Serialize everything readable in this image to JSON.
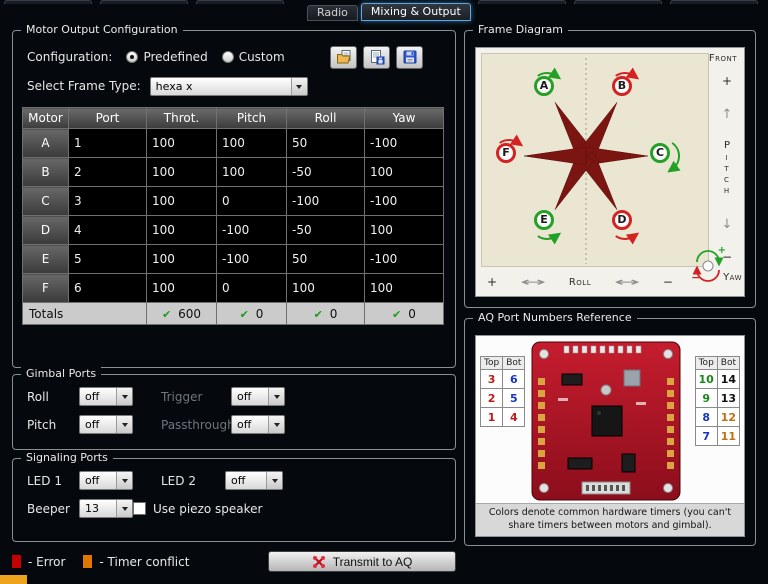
{
  "accent_color": "#5aa7e8",
  "tabs": {
    "radio": "Radio",
    "mixing": "Mixing & Output"
  },
  "motor_config": {
    "title": "Motor Output Configuration",
    "configuration_label": "Configuration:",
    "predefined_label": "Predefined",
    "custom_label": "Custom",
    "frame_type_label": "Select Frame Type:",
    "frame_type_value": "hexa x",
    "table": {
      "headers": [
        "Motor",
        "Port",
        "Throt.",
        "Pitch",
        "Roll",
        "Yaw"
      ],
      "rows": [
        [
          "A",
          "1",
          "100",
          "100",
          "50",
          "-100"
        ],
        [
          "B",
          "2",
          "100",
          "100",
          "-50",
          "100"
        ],
        [
          "C",
          "3",
          "100",
          "0",
          "-100",
          "-100"
        ],
        [
          "D",
          "4",
          "100",
          "-100",
          "-50",
          "100"
        ],
        [
          "E",
          "5",
          "100",
          "-100",
          "50",
          "-100"
        ],
        [
          "F",
          "6",
          "100",
          "0",
          "100",
          "100"
        ]
      ],
      "totals": {
        "label": "Totals",
        "check": "✔",
        "check_color": "#1d9b1d",
        "values": [
          "600",
          "0",
          "0",
          "0"
        ]
      }
    }
  },
  "gimbal": {
    "title": "Gimbal Ports",
    "roll_label": "Roll",
    "roll_value": "off",
    "trigger_label": "Trigger",
    "trigger_value": "off",
    "pitch_label": "Pitch",
    "pitch_value": "off",
    "passthrough_label": "Passthrough",
    "passthrough_value": "off"
  },
  "signaling": {
    "title": "Signaling Ports",
    "led1_label": "LED 1",
    "led1_value": "off",
    "led2_label": "LED 2",
    "led2_value": "off",
    "beeper_label": "Beeper",
    "beeper_value": "13",
    "piezo_label": "Use piezo speaker"
  },
  "footer": {
    "error_label": "- Error",
    "error_color": "#c40000",
    "timer_label": "- Timer conflict",
    "timer_color": "#e07800",
    "transmit_label": "Transmit to AQ"
  },
  "frame_diagram": {
    "title": "Frame Diagram",
    "front_label": "Front",
    "pitch_label": "Pitch",
    "roll_label": "Roll",
    "yaw_label": "Yaw",
    "plus": "+",
    "minus": "−",
    "icons": {
      "up_arrow": "↑",
      "down_arrow": "↓",
      "h_arrow": "↔"
    },
    "motors": [
      {
        "label": "A",
        "color": "#23a127"
      },
      {
        "label": "B",
        "color": "#d42222"
      },
      {
        "label": "C",
        "color": "#23a127"
      },
      {
        "label": "D",
        "color": "#d42222"
      },
      {
        "label": "E",
        "color": "#23a127"
      },
      {
        "label": "F",
        "color": "#d42222"
      }
    ]
  },
  "port_reference": {
    "title": "AQ Port Numbers Reference",
    "caption": "Colors denote common hardware timers (you can't share timers between motors and gimbal).",
    "left": {
      "headers": [
        "Top",
        "Bot"
      ],
      "rows": [
        [
          {
            "t": "3",
            "c": "#c01a1a"
          },
          {
            "t": "6",
            "c": "#1a35c0"
          }
        ],
        [
          {
            "t": "2",
            "c": "#c01a1a"
          },
          {
            "t": "5",
            "c": "#1a35c0"
          }
        ],
        [
          {
            "t": "1",
            "c": "#c01a1a"
          },
          {
            "t": "4",
            "c": "#c01a1a"
          }
        ]
      ]
    },
    "right": {
      "headers": [
        "Top",
        "Bot"
      ],
      "rows": [
        [
          {
            "t": "10",
            "c": "#168a16"
          },
          {
            "t": "14",
            "c": "#101010"
          }
        ],
        [
          {
            "t": "9",
            "c": "#168a16"
          },
          {
            "t": "13",
            "c": "#101010"
          }
        ],
        [
          {
            "t": "8",
            "c": "#1a35c0"
          },
          {
            "t": "12",
            "c": "#c07010"
          }
        ],
        [
          {
            "t": "7",
            "c": "#1a35c0"
          },
          {
            "t": "11",
            "c": "#c07010"
          }
        ]
      ]
    }
  }
}
